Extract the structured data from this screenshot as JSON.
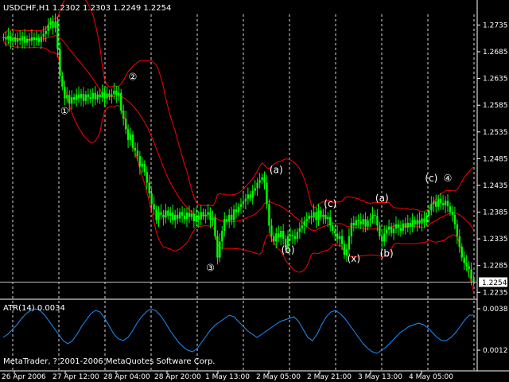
{
  "window": {
    "symbol_header": "USDCHF,H1  1.2302 1.2303 1.2249 1.2254",
    "current_price": "1.2254",
    "copyright": "MetaTrader, ? 2001-2006 MetaQuotes Software Corp."
  },
  "colors": {
    "background": "#000000",
    "grid": "#ffffff",
    "candle_up": "#00ff00",
    "bands": "#ff0000",
    "atr_line": "#1e90ff",
    "price_tag_bg": "#ffffff",
    "price_tag_fg": "#000000"
  },
  "chart_data": [
    {
      "type": "line",
      "subtype": "candlestick",
      "title": "USDCHF,H1",
      "ylim": [
        1.2225,
        1.2755
      ],
      "y_ticks": [
        "1.2735",
        "1.2685",
        "1.2635",
        "1.2585",
        "1.2535",
        "1.2485",
        "1.2435",
        "1.2385",
        "1.2335",
        "1.2285",
        "1.2235"
      ],
      "x_ticks": [
        "26 Apr 2006",
        "27 Apr 12:00",
        "28 Apr 04:00",
        "28 Apr 20:00",
        "1 May 13:00",
        "2 May 05:00",
        "2 May 21:00",
        "3 May 13:00",
        "4 May 05:00"
      ],
      "last_price": 1.2254,
      "grid": true,
      "wave_labels": [
        {
          "text": "①",
          "x": 26,
          "y": 1.2568
        },
        {
          "text": "②",
          "x": 55,
          "y": 1.2632
        },
        {
          "text": "③",
          "x": 88,
          "y": 1.2275
        },
        {
          "text": "(a)",
          "x": 116,
          "y": 1.2458
        },
        {
          "text": "(b)",
          "x": 121,
          "y": 1.2308
        },
        {
          "text": "(c)",
          "x": 139,
          "y": 1.2395
        },
        {
          "text": "(x)",
          "x": 149,
          "y": 1.2292
        },
        {
          "text": "(a)",
          "x": 161,
          "y": 1.2405
        },
        {
          "text": "(b)",
          "x": 163,
          "y": 1.2302
        },
        {
          "text": "(c)",
          "x": 182,
          "y": 1.2442
        },
        {
          "text": "④",
          "x": 189,
          "y": 1.2442
        }
      ],
      "close": [
        1.2712,
        1.2708,
        1.2715,
        1.2705,
        1.2712,
        1.2704,
        1.271,
        1.2706,
        1.2714,
        1.2702,
        1.2709,
        1.2705,
        1.2712,
        1.2707,
        1.2711,
        1.2703,
        1.2713,
        1.2718,
        1.2724,
        1.2735,
        1.2742,
        1.273,
        1.2742,
        1.269,
        1.264,
        1.262,
        1.2598,
        1.2604,
        1.2588,
        1.26,
        1.2595,
        1.2605,
        1.2598,
        1.2606,
        1.2593,
        1.2605,
        1.26,
        1.2597,
        1.2608,
        1.2596,
        1.2605,
        1.26,
        1.2609,
        1.2598,
        1.2607,
        1.2601,
        1.2605,
        1.2612,
        1.2604,
        1.2608,
        1.2575,
        1.256,
        1.254,
        1.252,
        1.253,
        1.2505,
        1.25,
        1.249,
        1.247,
        1.2475,
        1.246,
        1.244,
        1.242,
        1.24,
        1.239,
        1.237,
        1.2385,
        1.238,
        1.2375,
        1.2388,
        1.2378,
        1.2384,
        1.237,
        1.238,
        1.2373,
        1.2385,
        1.2378,
        1.2372,
        1.2384,
        1.2376,
        1.2382,
        1.2368,
        1.2378,
        1.2371,
        1.2385,
        1.2377,
        1.238,
        1.2385,
        1.237,
        1.2375,
        1.234,
        1.23,
        1.233,
        1.235,
        1.2372,
        1.2368,
        1.238,
        1.237,
        1.239,
        1.2385,
        1.2395,
        1.24,
        1.2405,
        1.241,
        1.2418,
        1.2412,
        1.2425,
        1.243,
        1.244,
        1.2445,
        1.245,
        1.244,
        1.24,
        1.236,
        1.234,
        1.233,
        1.2345,
        1.2338,
        1.235,
        1.2335,
        1.232,
        1.234,
        1.2342,
        1.234,
        1.2335,
        1.2348,
        1.2355,
        1.236,
        1.2368,
        1.2372,
        1.2378,
        1.2375,
        1.2385,
        1.237,
        1.2388,
        1.2376,
        1.238,
        1.2372,
        1.2376,
        1.236,
        1.235,
        1.2345,
        1.2335,
        1.234,
        1.2325,
        1.2305,
        1.2315,
        1.234,
        1.2365,
        1.236,
        1.237,
        1.2368,
        1.2362,
        1.2372,
        1.2358,
        1.237,
        1.2372,
        1.238,
        1.2378,
        1.236,
        1.234,
        1.233,
        1.2345,
        1.2352,
        1.2358,
        1.2346,
        1.2354,
        1.2362,
        1.2356,
        1.235,
        1.2364,
        1.2356,
        1.2365,
        1.2358,
        1.237,
        1.2362,
        1.237,
        1.2364,
        1.2373,
        1.2366,
        1.2378,
        1.2388,
        1.24,
        1.2405,
        1.2395,
        1.241,
        1.2402,
        1.2398,
        1.2406,
        1.2396,
        1.2385,
        1.238,
        1.2362,
        1.234,
        1.232,
        1.23,
        1.229,
        1.2284,
        1.2278,
        1.226,
        1.2254
      ],
      "atr_panel": {
        "label": "ATR(14) 0.0034",
        "ylim": [
          0.0008,
          0.0042
        ],
        "y_ticks": [
          "0.0038",
          "0.0012"
        ],
        "values": [
          0.002,
          0.0022,
          0.0025,
          0.0028,
          0.0032,
          0.0035,
          0.0037,
          0.0038,
          0.0037,
          0.0034,
          0.003,
          0.0026,
          0.0022,
          0.0018,
          0.0016,
          0.0018,
          0.0022,
          0.0027,
          0.0031,
          0.0035,
          0.0037,
          0.0036,
          0.0032,
          0.0027,
          0.0022,
          0.0019,
          0.0018,
          0.002,
          0.0024,
          0.0029,
          0.0033,
          0.0036,
          0.0038,
          0.0037,
          0.0034,
          0.003,
          0.0025,
          0.0021,
          0.0017,
          0.0014,
          0.0012,
          0.0011,
          0.0013,
          0.0017,
          0.0021,
          0.0025,
          0.0028,
          0.003,
          0.0032,
          0.0034,
          0.0033,
          0.003,
          0.0027,
          0.0024,
          0.0022,
          0.002,
          0.0022,
          0.0024,
          0.0026,
          0.0028,
          0.003,
          0.0031,
          0.0032,
          0.0033,
          0.003,
          0.0025,
          0.002,
          0.0018,
          0.0022,
          0.0028,
          0.0033,
          0.0036,
          0.0037,
          0.0035,
          0.0032,
          0.0028,
          0.0024,
          0.002,
          0.0016,
          0.0013,
          0.0011,
          0.001,
          0.0012,
          0.0014,
          0.0017,
          0.002,
          0.0023,
          0.0025,
          0.0027,
          0.0028,
          0.0029,
          0.0028,
          0.0026,
          0.0023,
          0.002,
          0.0018,
          0.0018,
          0.002,
          0.0023,
          0.0027,
          0.0031,
          0.0034,
          0.0034
        ]
      }
    }
  ]
}
